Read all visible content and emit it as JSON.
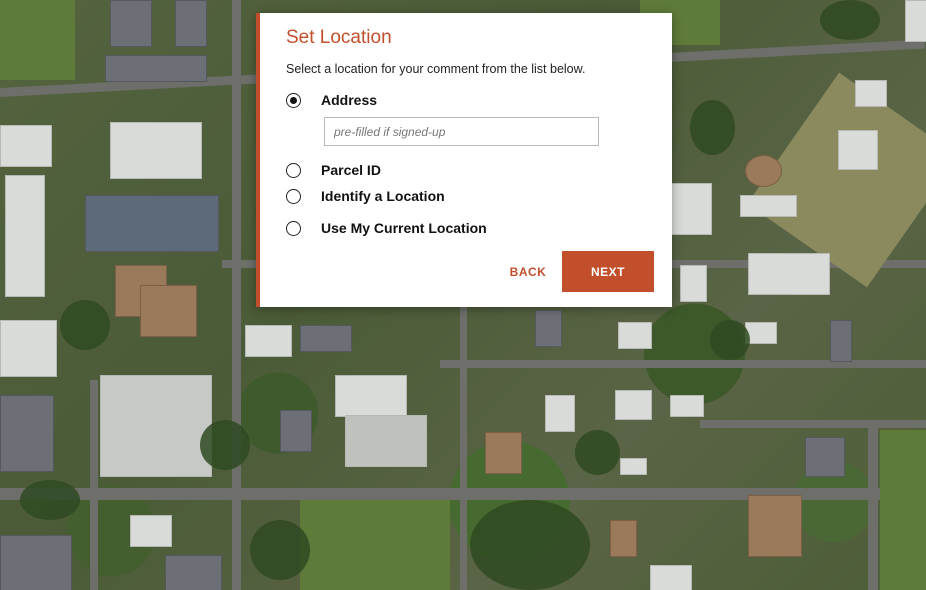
{
  "dialog": {
    "title": "Set Location",
    "subtitle": "Select a location for your comment from the list below.",
    "options": [
      {
        "label": "Address",
        "selected": true
      },
      {
        "label": "Parcel ID",
        "selected": false
      },
      {
        "label": "Identify a Location",
        "selected": false
      },
      {
        "label": "Use My Current Location",
        "selected": false
      }
    ],
    "address_input": {
      "value": "",
      "placeholder": "pre-filled if signed-up"
    },
    "back_label": "BACK",
    "next_label": "NEXT"
  },
  "colors": {
    "accent": "#c24f2b"
  },
  "map": {
    "type": "aerial satellite imagery"
  }
}
